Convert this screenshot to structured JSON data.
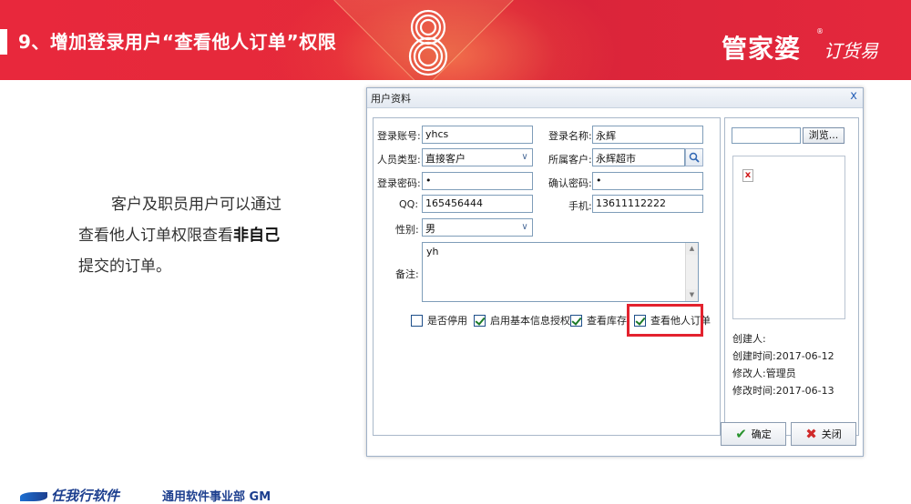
{
  "banner": {
    "title": "9、增加登录用户“查看他人订单”权限",
    "brand": "管家婆",
    "brand_reg": "®",
    "slogan": "订货易"
  },
  "description": {
    "line1": "客户及职员用户可以通过",
    "line2_prefix": "查看他人订单权限查看",
    "line2_bold": "非自己",
    "line3": "提交的订单。"
  },
  "dialog": {
    "title": "用户资料",
    "close": "x",
    "form": {
      "login_account_label": "登录账号:",
      "login_account_value": "yhcs",
      "login_name_label": "登录名称:",
      "login_name_value": "永辉",
      "person_type_label": "人员类型:",
      "person_type_value": "直接客户",
      "customer_label": "所属客户:",
      "customer_value": "永辉超市",
      "password_label": "登录密码:",
      "password_value": "•",
      "confirm_label": "确认密码:",
      "confirm_value": "•",
      "qq_label": "QQ:",
      "qq_value": "165456444",
      "phone_label": "手机:",
      "phone_value": "13611112222",
      "gender_label": "性别:",
      "gender_value": "男",
      "remark_label": "备注:",
      "remark_value": "yh"
    },
    "checkboxes": [
      {
        "label": "是否停用",
        "checked": false
      },
      {
        "label": "启用基本信息授权",
        "checked": true
      },
      {
        "label": "查看库存",
        "checked": true
      },
      {
        "label": "查看他人订单",
        "checked": true
      }
    ],
    "side": {
      "browse_label": "浏览...",
      "broken_image": "x",
      "creator": "创建人:",
      "created_time": "创建时间:2017-06-12",
      "modifier": "修改人:管理员",
      "modified_time": "修改时间:2017-06-13"
    },
    "buttons": {
      "ok": "确定",
      "close": "关闭"
    }
  },
  "footer": {
    "logo": "任我行软件",
    "dept": "通用软件事业部 GM"
  },
  "colors": {
    "banner_red": "#e4283b",
    "highlight_red": "#e3222e",
    "footer_blue": "#1d3f8f"
  }
}
